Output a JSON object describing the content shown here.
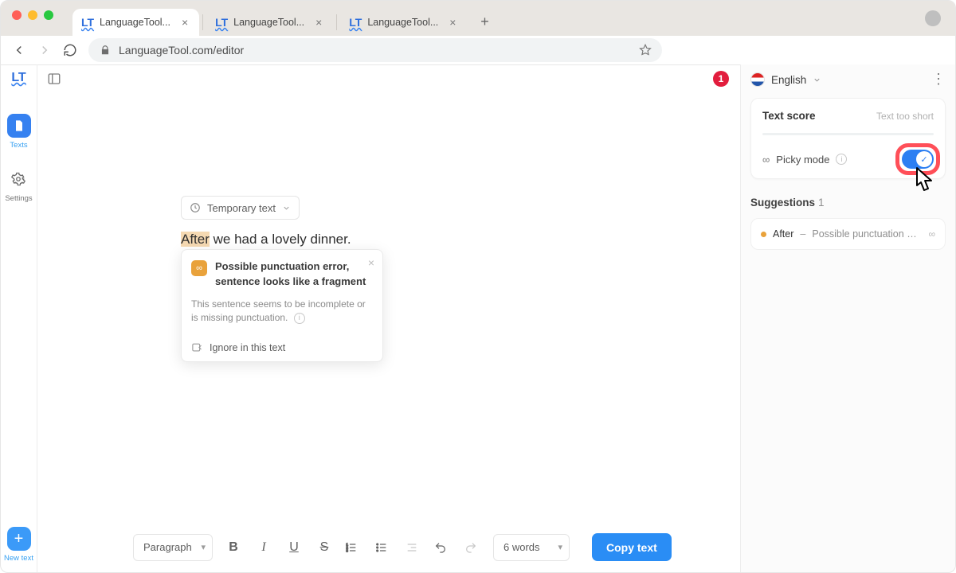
{
  "browser": {
    "tabs": [
      {
        "label": "LanguageTool..."
      },
      {
        "label": "LanguageTool..."
      },
      {
        "label": "LanguageTool..."
      }
    ],
    "url": "LanguageTool.com/editor"
  },
  "leftRail": {
    "textsLabel": "Texts",
    "settingsLabel": "Settings",
    "newTextLabel": "New text"
  },
  "editor": {
    "docChipLabel": "Temporary text",
    "highlight": "After",
    "rest": " we had a lovely dinner.",
    "popup": {
      "title": "Possible punctuation error, sentence looks like a fragment",
      "body": "This sentence seems to be incomplete or is missing punctuation.",
      "ignore": "Ignore in this text"
    },
    "errorCount": "1"
  },
  "toolbar": {
    "paragraphLabel": "Paragraph",
    "wordsLabel": "6 words",
    "copyLabel": "Copy text"
  },
  "rside": {
    "language": "English",
    "textScore": "Text score",
    "textScoreStatus": "Text too short",
    "pickyMode": "Picky mode",
    "suggestionsLabel": "Suggestions",
    "suggestionsCount": "1",
    "suggestion": {
      "word": "After",
      "desc": "Possible punctuation error, sent…"
    }
  }
}
